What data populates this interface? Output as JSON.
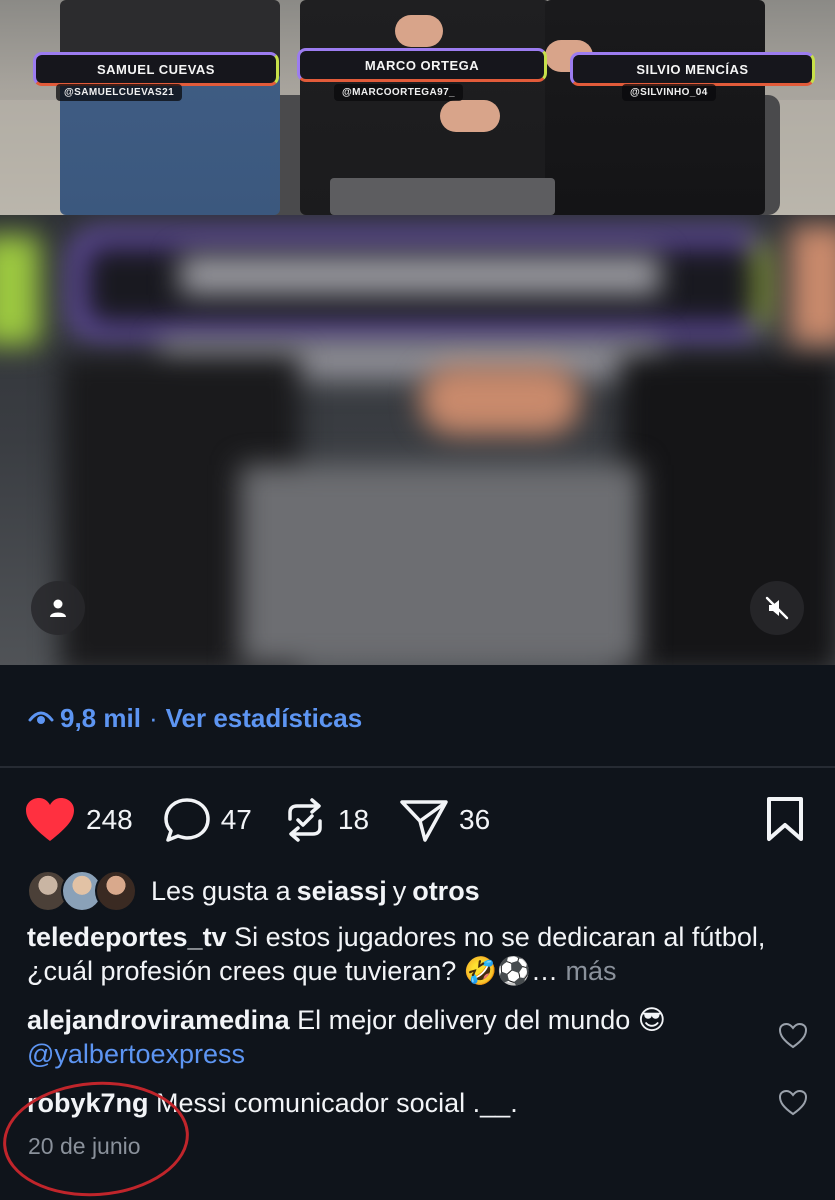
{
  "video": {
    "hosts": [
      {
        "name": "SAMUEL CUEVAS",
        "handle": "@SAMUELCUEVAS21"
      },
      {
        "name": "MARCO ORTEGA",
        "handle": "@MARCOORTEGA97_"
      },
      {
        "name": "SILVIO MENCÍAS",
        "handle": "@SILVINHO_04"
      }
    ]
  },
  "stats": {
    "views": "9,8 mil",
    "separator": "·",
    "link": "Ver estadísticas"
  },
  "actions": {
    "likes": "248",
    "comments": "47",
    "reposts": "18",
    "shares": "36"
  },
  "liked_by": {
    "prefix": "Les gusta a",
    "user": "seiassj",
    "conj": "y",
    "others": "otros"
  },
  "caption": {
    "user": "teledeportes_tv",
    "text": "Si estos jugadores no se dedicaran al fútbol, ¿cuál profesión crees que tuvieran? 🤣⚽…",
    "more": "más"
  },
  "comments": [
    {
      "user": "alejandroviramedina",
      "text": "El mejor delivery del mundo 😎",
      "mention": "@yalbertoexpress"
    },
    {
      "user": "robyk7ng",
      "text": "Messi comunicador social .__."
    }
  ],
  "date": "20 de junio",
  "colors": {
    "accent": "#5d95f2",
    "like": "#ff3040",
    "annotation": "#c0252b"
  }
}
